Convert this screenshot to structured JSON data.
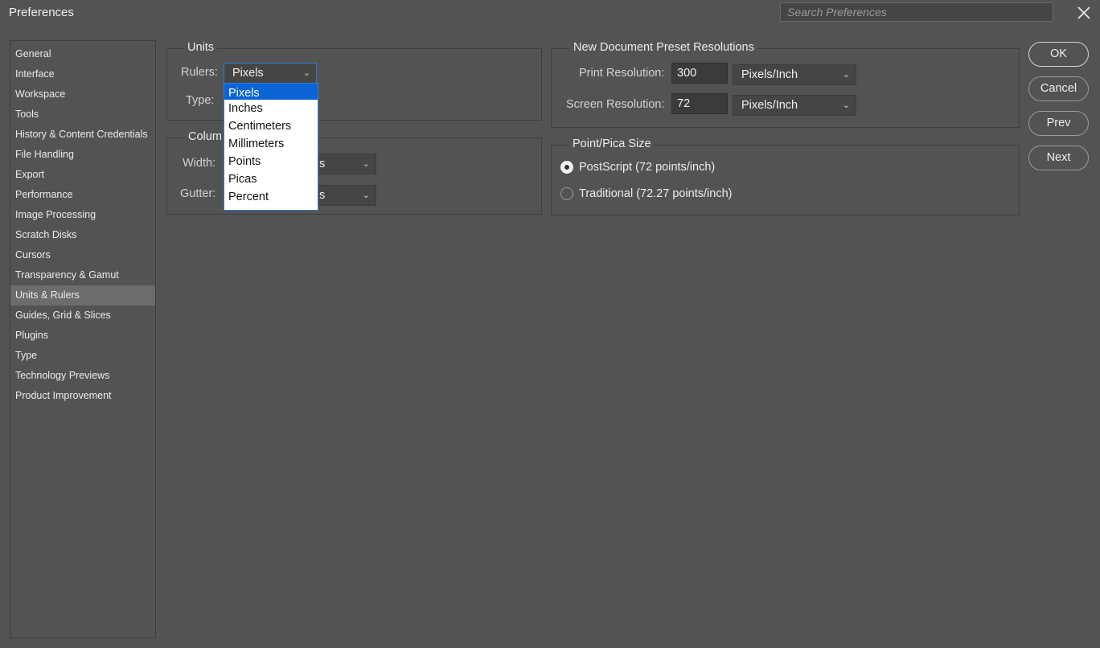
{
  "window": {
    "title": "Preferences"
  },
  "search": {
    "placeholder": "Search Preferences"
  },
  "sidebar": {
    "items": [
      {
        "label": "General"
      },
      {
        "label": "Interface"
      },
      {
        "label": "Workspace"
      },
      {
        "label": "Tools"
      },
      {
        "label": "History & Content Credentials"
      },
      {
        "label": "File Handling"
      },
      {
        "label": "Export"
      },
      {
        "label": "Performance"
      },
      {
        "label": "Image Processing"
      },
      {
        "label": "Scratch Disks"
      },
      {
        "label": "Cursors"
      },
      {
        "label": "Transparency & Gamut"
      },
      {
        "label": "Units & Rulers"
      },
      {
        "label": "Guides, Grid & Slices"
      },
      {
        "label": "Plugins"
      },
      {
        "label": "Type"
      },
      {
        "label": "Technology Previews"
      },
      {
        "label": "Product Improvement"
      }
    ],
    "selected": "Units & Rulers"
  },
  "units": {
    "legend": "Units",
    "rulers_label": "Rulers:",
    "rulers_value": "Pixels",
    "type_label": "Type:"
  },
  "columns": {
    "legend_visible": "Colum",
    "width_label": "Width:",
    "width_unit_visible": "s",
    "gutter_label": "Gutter:",
    "gutter_unit_visible": "s"
  },
  "dropdown": {
    "options": [
      "Pixels",
      "Inches",
      "Centimeters",
      "Millimeters",
      "Points",
      "Picas",
      "Percent"
    ],
    "selected": "Pixels"
  },
  "resolutions": {
    "legend": "New Document Preset Resolutions",
    "print_label": "Print Resolution:",
    "print_value": "300",
    "print_unit": "Pixels/Inch",
    "screen_label": "Screen Resolution:",
    "screen_value": "72",
    "screen_unit": "Pixels/Inch"
  },
  "pica": {
    "legend": "Point/Pica Size",
    "options": [
      {
        "label": "PostScript (72 points/inch)",
        "checked": true
      },
      {
        "label": "Traditional (72.27 points/inch)",
        "checked": false
      }
    ]
  },
  "buttons": {
    "ok": "OK",
    "cancel": "Cancel",
    "prev": "Prev",
    "next": "Next"
  },
  "icons": {
    "close": "close-icon",
    "chevron": "chevron-down-icon"
  },
  "colors": {
    "selection": "#0a64d6",
    "sidebar_active": "#6c6c6c",
    "background": "#535353"
  }
}
